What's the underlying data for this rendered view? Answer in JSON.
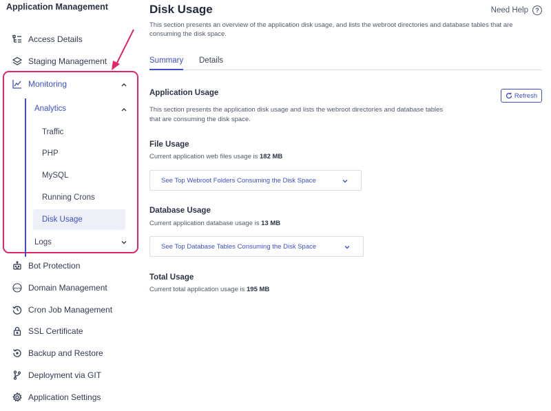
{
  "sidebar": {
    "title": "Application Management",
    "items": {
      "access_details": "Access Details",
      "staging": "Staging Management",
      "monitoring": "Monitoring",
      "bot_protection": "Bot Protection",
      "domain": "Domain Management",
      "cron": "Cron Job Management",
      "ssl": "SSL Certificate",
      "backup": "Backup and Restore",
      "deployment": "Deployment via GIT",
      "app_settings": "Application Settings"
    },
    "analytics": "Analytics",
    "sub": {
      "traffic": "Traffic",
      "php": "PHP",
      "mysql": "MySQL",
      "running_crons": "Running Crons",
      "disk_usage": "Disk Usage"
    },
    "logs": "Logs"
  },
  "main": {
    "title": "Disk Usage",
    "need_help": "Need Help",
    "description": "This section presents an overview of the application disk usage, and lists the webroot directories and database tables that are consuming the disk space.",
    "tabs": {
      "summary": "Summary",
      "details": "Details"
    },
    "app_usage": {
      "title": "Application Usage",
      "refresh": "Refresh",
      "desc_line1": "This section presents the application disk usage and lists the webroot directories and database tables",
      "desc_line2": "that are consuming the disk space."
    },
    "file_usage": {
      "title": "File Usage",
      "text": "Current application web files usage is",
      "value": "182 MB",
      "dropdown": "See Top Webroot Folders Consuming the Disk Space"
    },
    "db_usage": {
      "title": "Database Usage",
      "text": "Current application database usage is",
      "value": "13 MB",
      "dropdown": "See Top Database Tables Consuming the Disk Space"
    },
    "total_usage": {
      "title": "Total Usage",
      "text": "Current total application usage is",
      "value": "195 MB"
    }
  },
  "colors": {
    "accent": "#3d4fc8",
    "highlight": "#e62565"
  }
}
